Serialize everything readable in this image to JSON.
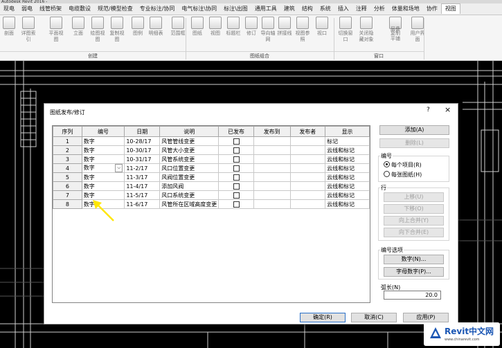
{
  "app": {
    "title_fragment": "Autodesk Revit 2016 - "
  },
  "menu": [
    "现电",
    "弱电",
    "线管桥架",
    "电缆敷设",
    "规范/模型检查",
    "专业标注/协同",
    "电气标注\\协同",
    "标注\\出图",
    "通用工具",
    "建筑",
    "结构",
    "系统",
    "插入",
    "注释",
    "分析",
    "体量和场地",
    "协作",
    "视图"
  ],
  "menu_active_index": 17,
  "ribbon": {
    "tools": [
      "剖面",
      "详图索引",
      "平面视图",
      "立面",
      "绘图视图",
      "复制视图",
      "图例",
      "明细表",
      "范围框",
      "图纸",
      "视图",
      "标题栏",
      "修订",
      "导向轴网",
      "拼接线",
      "视图参照",
      "视口",
      "切换窗口",
      "关闭隐藏对象",
      "复制",
      "层叠",
      "平铺",
      "用户界面"
    ],
    "groups": [
      "创建",
      "图纸组合",
      "窗口"
    ]
  },
  "dialog": {
    "title": "图纸发布/修订",
    "help": "?",
    "close": "×",
    "columns": [
      "序列",
      "编号",
      "日期",
      "说明",
      "已发布",
      "发布到",
      "发布者",
      "显示"
    ],
    "rows": [
      {
        "seq": "1",
        "num": "数字",
        "date": "10-28/17",
        "desc": "风管管线变更",
        "show": "标记"
      },
      {
        "seq": "2",
        "num": "数字",
        "date": "10-30/17",
        "desc": "风管大小变更",
        "show": "云线和标记"
      },
      {
        "seq": "3",
        "num": "数字",
        "date": "10-31/17",
        "desc": "风管系统变更",
        "show": "云线和标记"
      },
      {
        "seq": "4",
        "num": "数字",
        "date": "11-2/17",
        "desc": "风口位置变更",
        "show": "云线和标记"
      },
      {
        "seq": "5",
        "num": "数字",
        "date": "11-3/17",
        "desc": "风阀位置变更",
        "show": "云线和标记"
      },
      {
        "seq": "6",
        "num": "数字",
        "date": "11-4/17",
        "desc": "添加风阀",
        "show": "云线和标记"
      },
      {
        "seq": "7",
        "num": "数字",
        "date": "11-5/17",
        "desc": "风口系统变更",
        "show": "云线和标记"
      },
      {
        "seq": "8",
        "num": "数字",
        "date": "11-6/17",
        "desc": "风管所在区域高度变更",
        "show": "云线和标记"
      }
    ],
    "dropdown_glyph": "⌵",
    "buttons": {
      "add": "添加(A)",
      "delete": "删除(L)",
      "move_up": "上移(U)",
      "move_down": "下移(O)",
      "merge_up": "向上合并(Y)",
      "merge_down": "向下合并(E)",
      "numeric": "数字(N)...",
      "alphanumeric": "字母数字(P)...",
      "ok": "确定(R)",
      "cancel": "取消(C)",
      "apply": "应用(P)"
    },
    "numbering": {
      "label": "编号",
      "options": [
        "每个项目(R)",
        "每张图纸(H)"
      ],
      "selected_index": 0
    },
    "row_group_label": "行",
    "numbering_options_label": "编号选项",
    "arc_length": {
      "label": "弧长(N)",
      "value": "20.0"
    }
  },
  "watermark": {
    "text": "Revit中文网",
    "url": "www.chinarevit.com"
  },
  "colors": {
    "accent": "#2a70c8",
    "arrow": "#ffe600"
  }
}
